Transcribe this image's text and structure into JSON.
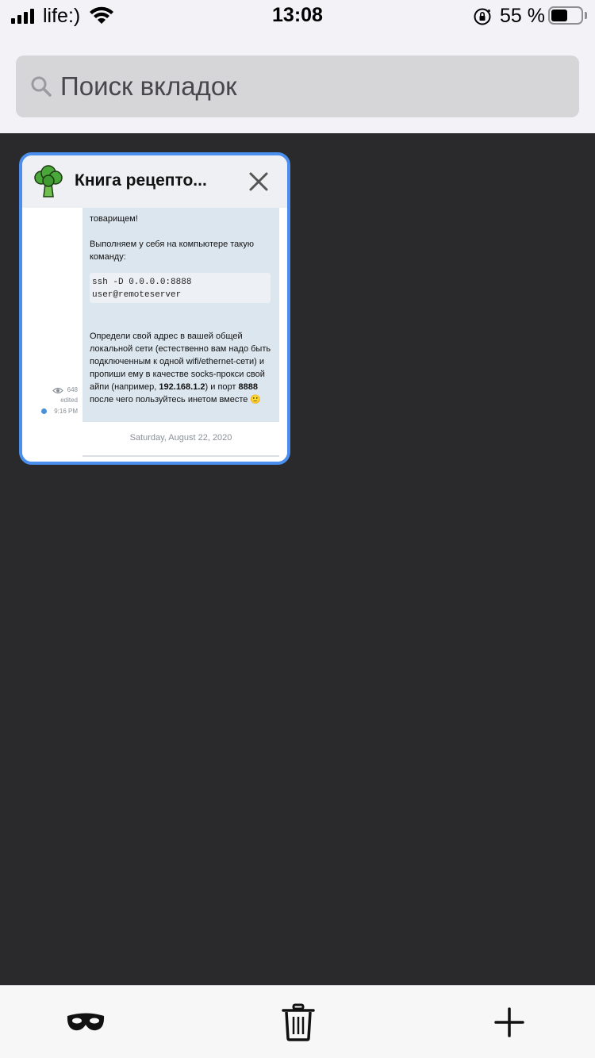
{
  "status_bar": {
    "carrier": "life:)",
    "time": "13:08",
    "battery_percent": "55 %",
    "battery_level": 0.55
  },
  "search": {
    "placeholder": "Поиск вкладок",
    "icon": "search-icon"
  },
  "tabs": [
    {
      "title": "Книга рецепто...",
      "favicon": "broccoli-icon",
      "selected": true,
      "preview": {
        "partial_top": "товарищем!",
        "paragraph1": "Выполняем у себя на компьютере такую команду:",
        "code": "ssh -D 0.0.0.0:8888 user@remoteserver",
        "paragraph2_start": "Определи свой адрес в вашей общей локальной сети (естественно вам надо быть подключенным к одной wifi/ethernet-сети) и пропиши ему в качестве socks-прокси свой айпи (например, ",
        "ip": "192.168.1.2",
        "paragraph2_mid": ") и порт ",
        "port": "8888",
        "paragraph2_end": " после чего пользуйтесь инетом вместе 🙂",
        "views": "648",
        "edited": "edited",
        "time": "9:16 PM",
        "date": "Saturday, August 22, 2020"
      }
    }
  ],
  "toolbar": {
    "private_icon": "mask-icon",
    "delete_icon": "trash-icon",
    "add_icon": "plus-icon"
  },
  "colors": {
    "selected_border": "#4a8fee",
    "background": "#2a2a2c",
    "header_bg": "#f2f2f7"
  }
}
